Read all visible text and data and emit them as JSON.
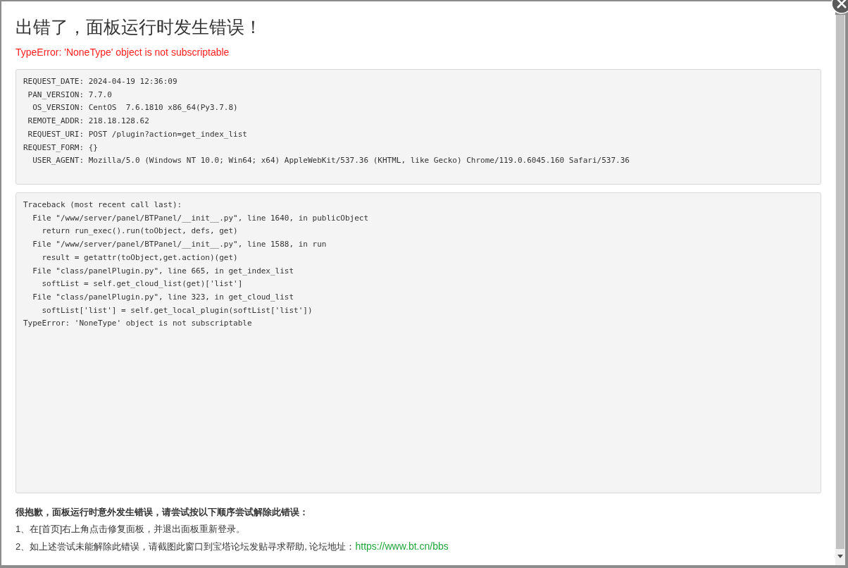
{
  "dialog": {
    "title": "出错了，面板运行时发生错误！",
    "error_message": "TypeError: 'NoneType' object is not subscriptable",
    "request_info": [
      "REQUEST_DATE: 2024-04-19 12:36:09",
      " PAN_VERSION: 7.7.0",
      "  OS_VERSION: CentOS  7.6.1810 x86_64(Py3.7.8)",
      " REMOTE_ADDR: 218.18.128.62",
      " REQUEST_URI: POST /plugin?action=get_index_list",
      "REQUEST_FORM: {}",
      "  USER_AGENT: Mozilla/5.0 (Windows NT 10.0; Win64; x64) AppleWebKit/537.36 (KHTML, like Gecko) Chrome/119.0.6045.160 Safari/537.36"
    ],
    "traceback": [
      "Traceback (most recent call last):",
      "  File \"/www/server/panel/BTPanel/__init__.py\", line 1640, in publicObject",
      "    return run_exec().run(toObject, defs, get)",
      "  File \"/www/server/panel/BTPanel/__init__.py\", line 1588, in run",
      "    result = getattr(toObject,get.action)(get)",
      "  File \"class/panelPlugin.py\", line 665, in get_index_list",
      "    softList = self.get_cloud_list(get)['list']",
      "  File \"class/panelPlugin.py\", line 323, in get_cloud_list",
      "    softList['list'] = self.get_local_plugin(softList['list'])",
      "TypeError: 'NoneType' object is not subscriptable"
    ],
    "help": {
      "heading": "很抱歉，面板运行时意外发生错误，请尝试按以下顺序尝试解除此错误：",
      "steps": [
        {
          "text": "1、在[首页]右上角点击修复面板，并退出面板重新登录。"
        },
        {
          "text": "2、如上述尝试未能解除此错误，请截图此窗口到宝塔论坛发贴寻求帮助, 论坛地址：",
          "link": "https://www.bt.cn/bbs"
        }
      ]
    }
  }
}
